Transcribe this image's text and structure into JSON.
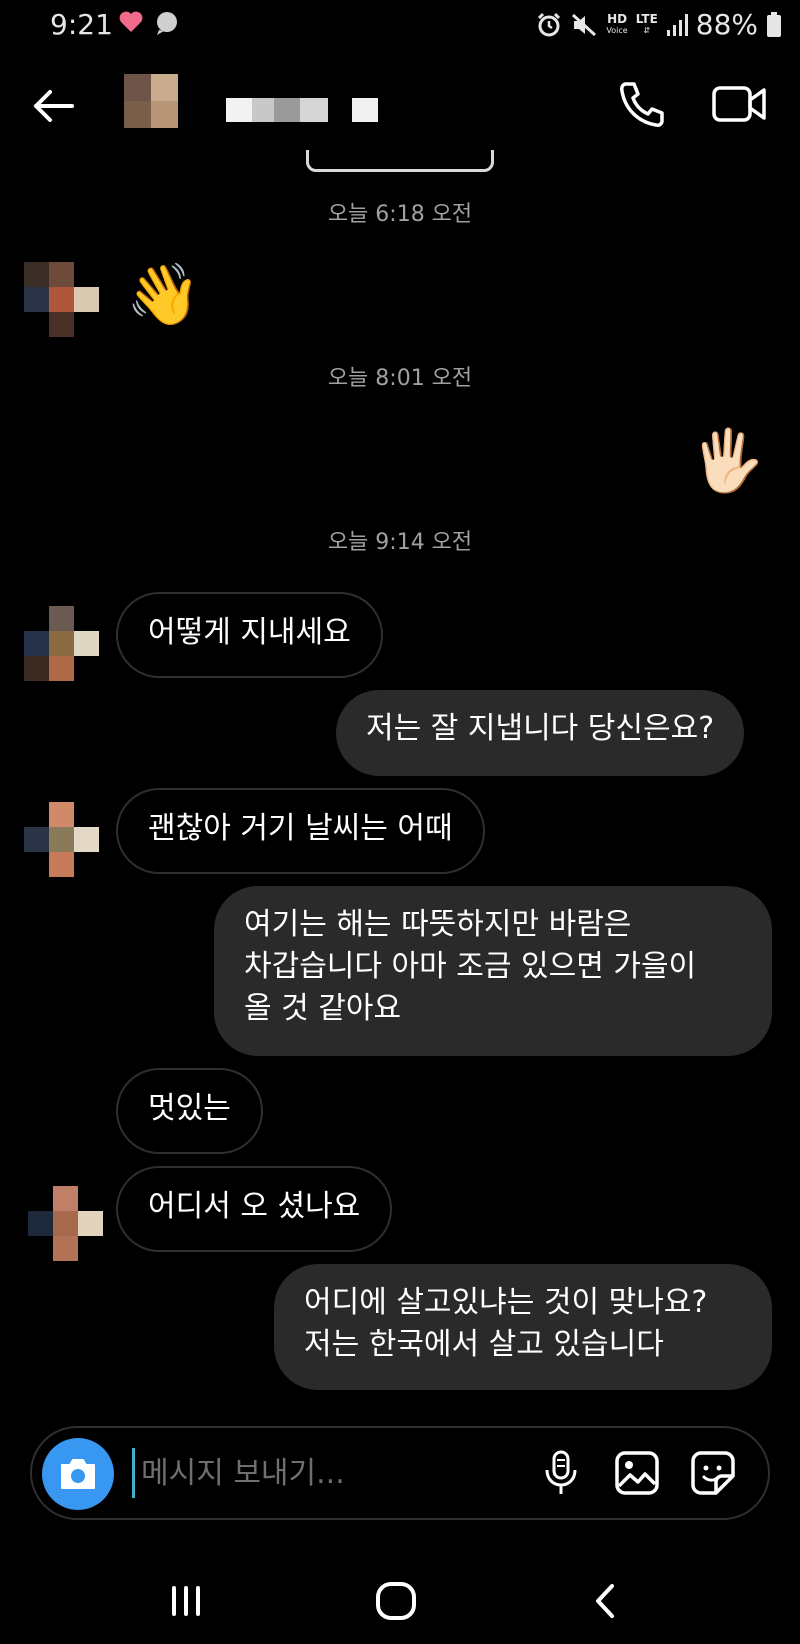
{
  "status_bar": {
    "time": "9:21",
    "battery": "88%",
    "hd_label": "HD",
    "hd_sub": "Voice",
    "lte_label": "LTE",
    "icons": [
      "heart-icon",
      "chat-bubble-icon",
      "alarm-icon",
      "mute-icon",
      "signal-icon",
      "battery-icon"
    ]
  },
  "header": {
    "icons": [
      "back-arrow-icon",
      "phone-icon",
      "video-camera-icon"
    ]
  },
  "thread": {
    "timestamps": [
      "오늘 6:18 오전",
      "오늘 8:01 오전",
      "오늘 9:14 오전"
    ],
    "messages": [
      {
        "from": "them",
        "type": "emoji",
        "text": "👋"
      },
      {
        "from": "me",
        "type": "emoji",
        "text": "🖐🏻"
      },
      {
        "from": "them",
        "type": "text",
        "text": "어떻게 지내세요"
      },
      {
        "from": "me",
        "type": "text",
        "text": "저는 잘 지냅니다 당신은요?"
      },
      {
        "from": "them",
        "type": "text",
        "text": "괜찮아 거기 날씨는 어때"
      },
      {
        "from": "me",
        "type": "text",
        "lines": [
          "여기는 해는 따뜻하지만 바람은",
          "차갑습니다 아마 조금 있으면 가을이",
          "올 것 같아요"
        ]
      },
      {
        "from": "them",
        "type": "text",
        "text": "멋있는"
      },
      {
        "from": "them",
        "type": "text",
        "text": "어디서 오 셨나요"
      },
      {
        "from": "me",
        "type": "text",
        "lines": [
          "어디에 살고있냐는 것이 맞나요?",
          "저는 한국에서 살고 있습니다"
        ]
      }
    ]
  },
  "composer": {
    "placeholder": "메시지 보내기...",
    "icons": [
      "camera-icon",
      "microphone-icon",
      "gallery-icon",
      "sticker-icon"
    ]
  },
  "navbar": {
    "icons": [
      "recent-apps-icon",
      "home-icon",
      "back-icon"
    ]
  },
  "colors": {
    "background": "#000000",
    "outgoing_bubble": "#2a2a2a",
    "incoming_border": "#2f2f2f",
    "camera_button": "#3897f0",
    "timestamp": "#a0a0a0"
  }
}
